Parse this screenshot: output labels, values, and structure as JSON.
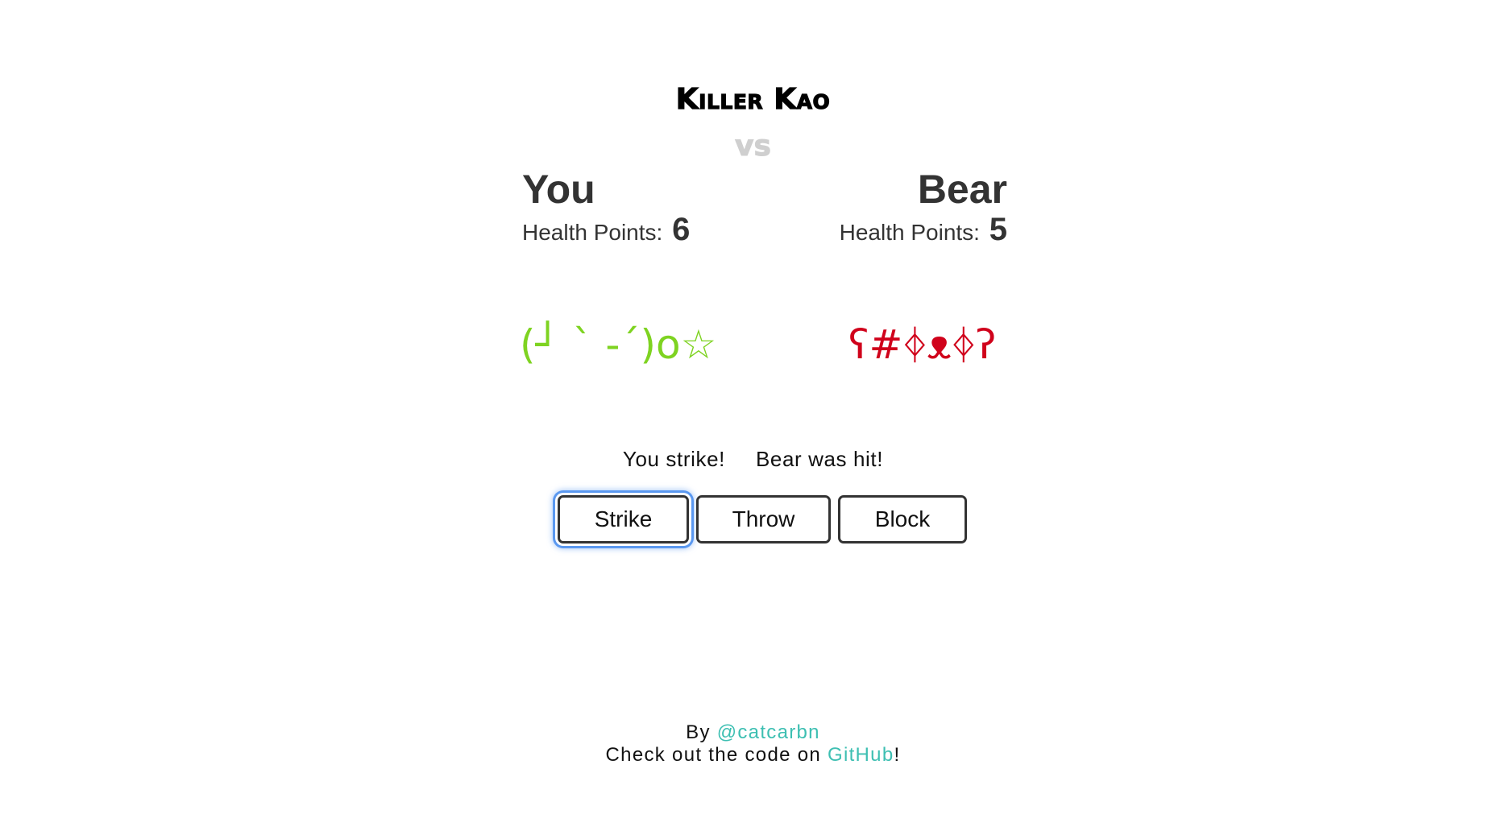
{
  "title": "Killer Kao",
  "vs": "vs",
  "player": {
    "name": "You",
    "hp_label": "Health Points:",
    "hp_value": "6",
    "kaomoji": "(┘ ` -´)o☆",
    "color": "#7ed321"
  },
  "opponent": {
    "name": "Bear",
    "hp_label": "Health Points:",
    "hp_value": "5",
    "kaomoji": "ʕ#ᛄᴥᛄʔ",
    "color": "#d0021b"
  },
  "log": {
    "player_action": "You strike!",
    "opponent_result": "Bear was hit!"
  },
  "actions": {
    "strike": "Strike",
    "throw": "Throw",
    "block": "Block"
  },
  "footer": {
    "by_prefix": "By",
    "author_link": "@catcarbn",
    "code_prefix": "Check out the code on",
    "github_link": "GitHub",
    "code_suffix": "!"
  },
  "colors": {
    "accent_link": "#3dbfb2",
    "focus_ring": "#5a98f0"
  }
}
